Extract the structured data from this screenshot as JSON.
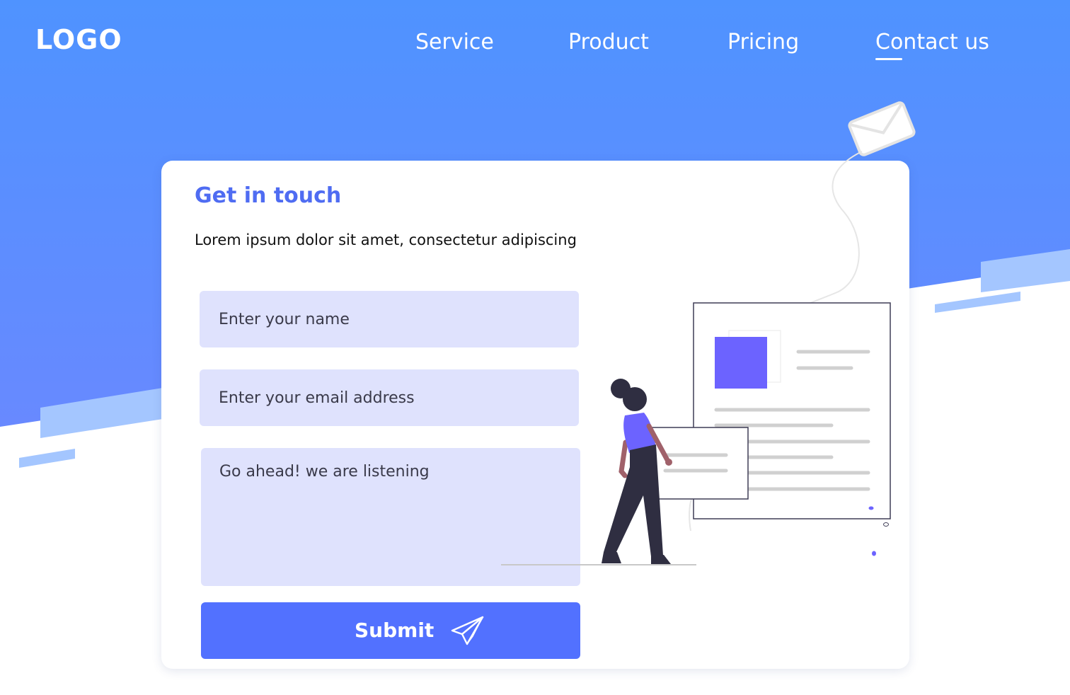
{
  "header": {
    "logo": "LOGO",
    "nav": [
      {
        "label": "Service"
      },
      {
        "label": "Product"
      },
      {
        "label": "Pricing"
      },
      {
        "label": "Contact us",
        "active": true
      }
    ]
  },
  "contact": {
    "title": "Get in touch",
    "description": "Lorem ipsum dolor sit amet, consectetur adipiscing",
    "name_placeholder": "Enter your name",
    "email_placeholder": "Enter your email address",
    "message_placeholder": "Go ahead! we are listening",
    "submit_label": "Submit",
    "submit_icon": "paper-plane-icon"
  },
  "illustration": {
    "icons": [
      "envelope-icon",
      "document-page",
      "person-figure"
    ]
  },
  "colors": {
    "hero_gradient_top": "#4f93ff",
    "hero_gradient_bottom": "#6889ff",
    "accent": "#5271ff",
    "title": "#4f6cf2",
    "field_bg": "#dfe2fd",
    "illustration_purple": "#6c63ff"
  }
}
